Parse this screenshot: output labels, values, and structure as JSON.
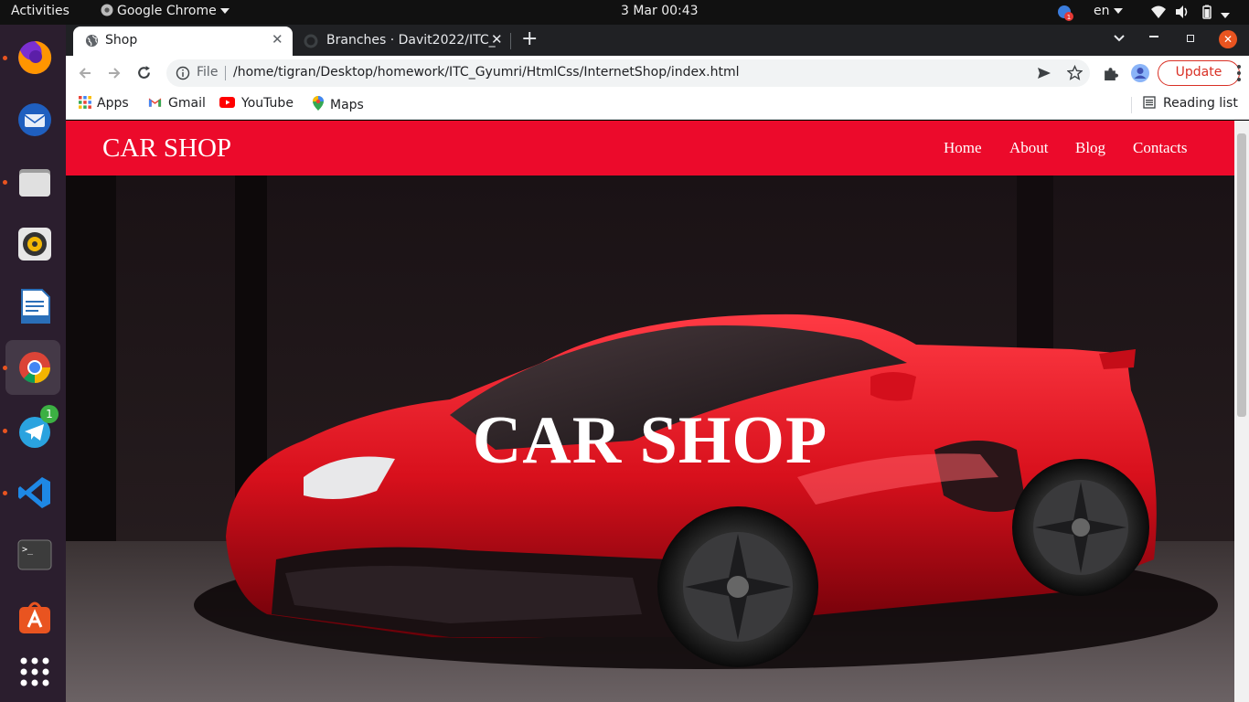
{
  "system": {
    "activities": "Activities",
    "app_name": "Google Chrome",
    "datetime": "3 Mar  00:43",
    "language": "en",
    "notification_count": "1",
    "telegram_badge": "1"
  },
  "dock": {
    "items": [
      {
        "name": "firefox-icon",
        "running": true
      },
      {
        "name": "thunderbird-icon",
        "running": false
      },
      {
        "name": "files-icon",
        "running": true
      },
      {
        "name": "rhythmbox-icon",
        "running": false
      },
      {
        "name": "libreoffice-writer-icon",
        "running": false
      },
      {
        "name": "chrome-icon",
        "running": true
      },
      {
        "name": "telegram-icon",
        "running": true
      },
      {
        "name": "vscode-icon",
        "running": true
      },
      {
        "name": "terminal-icon",
        "running": false
      },
      {
        "name": "software-center-icon",
        "running": false
      },
      {
        "name": "show-apps-icon",
        "running": false
      }
    ]
  },
  "browser": {
    "tabs": [
      {
        "label": "Shop",
        "active": true
      },
      {
        "label": "Branches · Davit2022/ITC_",
        "active": false
      }
    ],
    "address_scheme": "File",
    "address_url": "/home/tigran/Desktop/homework/ITC_Gyumri/HtmlCss/InternetShop/index.html",
    "update_label": "Update",
    "bookmarks": [
      {
        "label": "Apps",
        "icon": "apps-grid-icon"
      },
      {
        "label": "Gmail",
        "icon": "gmail-icon"
      },
      {
        "label": "YouTube",
        "icon": "youtube-icon"
      },
      {
        "label": "Maps",
        "icon": "maps-icon"
      }
    ],
    "reading_list": "Reading list"
  },
  "page": {
    "brand": "CAR SHOP",
    "nav": [
      "Home",
      "About",
      "Blog",
      "Contacts"
    ],
    "hero_title": "CAR SHOP",
    "accent_color": "#ec0a2b"
  }
}
